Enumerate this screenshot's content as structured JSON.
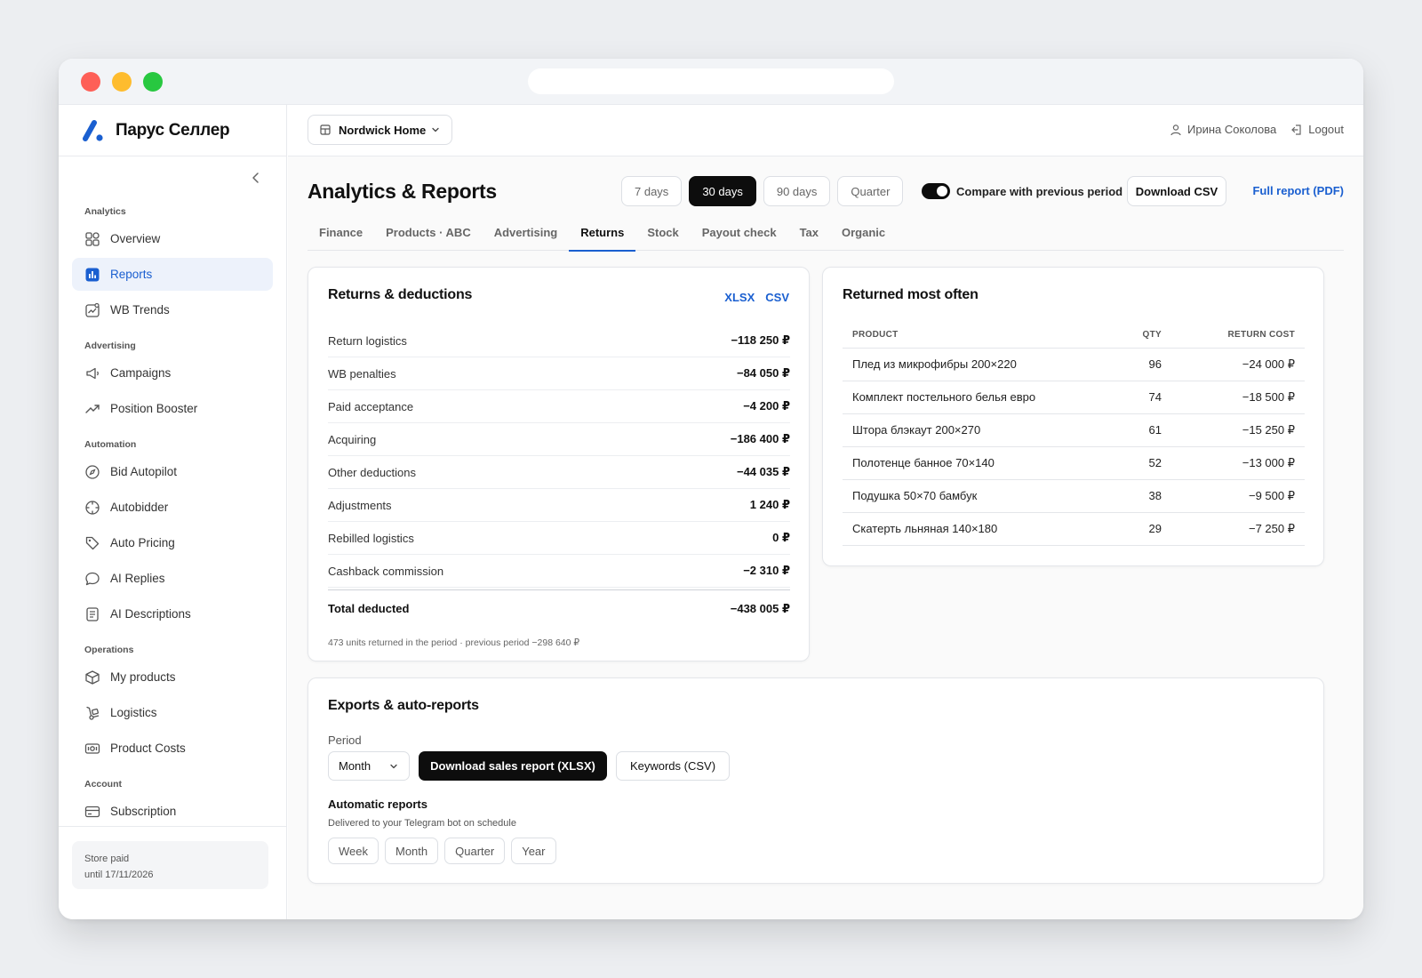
{
  "brand": {
    "name": "Парус Селлер",
    "accent": "#1a5fd0"
  },
  "sidebar": {
    "sections": [
      {
        "title": "Analytics",
        "items": [
          {
            "label": "Overview",
            "icon": "grid-icon"
          },
          {
            "label": "Reports",
            "icon": "bar-chart-icon",
            "active": true
          },
          {
            "label": "WB Trends",
            "icon": "trend-image-icon"
          }
        ]
      },
      {
        "title": "Advertising",
        "items": [
          {
            "label": "Campaigns",
            "icon": "megaphone-icon"
          },
          {
            "label": "Position Booster",
            "icon": "trending-up-icon"
          }
        ]
      },
      {
        "title": "Automation",
        "items": [
          {
            "label": "Bid Autopilot",
            "icon": "compass-icon"
          },
          {
            "label": "Autobidder",
            "icon": "crosshair-icon"
          },
          {
            "label": "Auto Pricing",
            "icon": "tag-icon"
          },
          {
            "label": "AI Replies",
            "icon": "chat-bubble-icon"
          },
          {
            "label": "AI Descriptions",
            "icon": "document-icon"
          }
        ]
      },
      {
        "title": "Operations",
        "items": [
          {
            "label": "My products",
            "icon": "box-icon"
          },
          {
            "label": "Logistics",
            "icon": "hand-truck-icon"
          },
          {
            "label": "Product Costs",
            "icon": "banknote-icon"
          }
        ]
      },
      {
        "title": "Account",
        "items": [
          {
            "label": "Subscription",
            "icon": "credit-card-icon"
          }
        ]
      }
    ],
    "store_status": {
      "line1": "Store paid",
      "line2": "until 17/11/2026"
    }
  },
  "topbar": {
    "store": "Nordwick Home",
    "user": "Ирина Соколова",
    "logout": "Logout"
  },
  "header": {
    "title": "Analytics & Reports",
    "ranges": [
      {
        "label": "7 days"
      },
      {
        "label": "30 days",
        "active": true
      },
      {
        "label": "90 days"
      },
      {
        "label": "Quarter"
      }
    ],
    "compare_label": "Compare with previous period",
    "compare_on": true,
    "download_csv": "Download CSV",
    "full_report": "Full report (PDF)"
  },
  "tabs": [
    {
      "label": "Finance"
    },
    {
      "label": "Products · ABC"
    },
    {
      "label": "Advertising"
    },
    {
      "label": "Returns",
      "active": true
    },
    {
      "label": "Stock"
    },
    {
      "label": "Payout check"
    },
    {
      "label": "Tax"
    },
    {
      "label": "Organic"
    }
  ],
  "returns_card": {
    "title": "Returns & deductions",
    "links": [
      "XLSX",
      "CSV"
    ],
    "rows": [
      {
        "label": "Return logistics",
        "value": "−118 250 ₽"
      },
      {
        "label": "WB penalties",
        "value": "−84 050 ₽"
      },
      {
        "label": "Paid acceptance",
        "value": "−4 200 ₽"
      },
      {
        "label": "Acquiring",
        "value": "−186 400 ₽"
      },
      {
        "label": "Other deductions",
        "value": "−44 035 ₽"
      },
      {
        "label": "Adjustments",
        "value": "1 240 ₽"
      },
      {
        "label": "Rebilled logistics",
        "value": "0 ₽"
      },
      {
        "label": "Cashback commission",
        "value": "−2 310 ₽"
      }
    ],
    "total_label": "Total deducted",
    "total_value": "−438 005 ₽",
    "note": "473 units returned in the period · previous period −298 640 ₽"
  },
  "most_returned": {
    "title": "Returned most often",
    "columns": [
      "PRODUCT",
      "QTY",
      "RETURN COST"
    ],
    "rows": [
      {
        "product": "Плед из микрофибры 200×220",
        "qty": "96",
        "cost": "−24 000 ₽"
      },
      {
        "product": "Комплект постельного белья евро",
        "qty": "74",
        "cost": "−18 500 ₽"
      },
      {
        "product": "Штора блэкаут 200×270",
        "qty": "61",
        "cost": "−15 250 ₽"
      },
      {
        "product": "Полотенце банное 70×140",
        "qty": "52",
        "cost": "−13 000 ₽"
      },
      {
        "product": "Подушка 50×70 бамбук",
        "qty": "38",
        "cost": "−9 500 ₽"
      },
      {
        "product": "Скатерть льняная 140×180",
        "qty": "29",
        "cost": "−7 250 ₽"
      }
    ]
  },
  "exports": {
    "title": "Exports & auto-reports",
    "period_label": "Period",
    "period_value": "Month",
    "download_sales": "Download sales report (XLSX)",
    "keywords": "Keywords (CSV)",
    "auto_title": "Automatic reports",
    "auto_sub": "Delivered to your Telegram bot on schedule",
    "schedule_options": [
      "Week",
      "Month",
      "Quarter",
      "Year"
    ]
  }
}
